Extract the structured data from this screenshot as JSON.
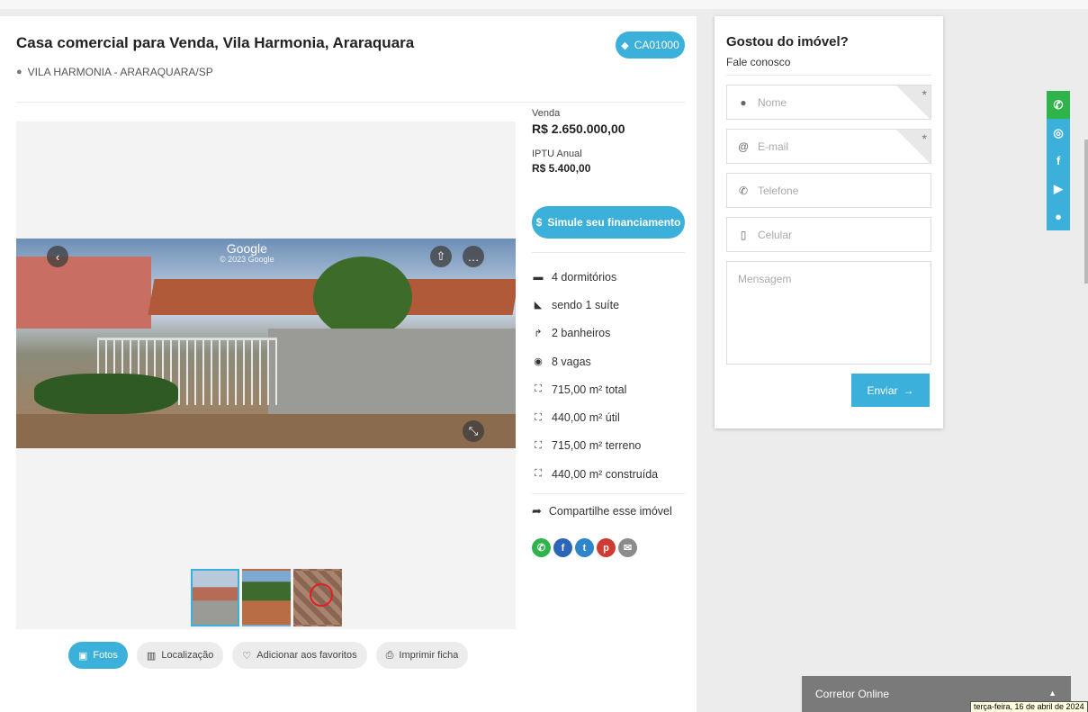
{
  "property": {
    "title": "Casa comercial para Venda, Vila Harmonia, Araraquara",
    "location": "VILA HARMONIA - ARARAQUARA/SP",
    "code": "CA01000"
  },
  "photo": {
    "google_label": "Google",
    "google_copy": "© 2023 Google"
  },
  "pricing": {
    "sale_label": "Venda",
    "sale_price": "R$ 2.650.000,00",
    "iptu_label": "IPTU Anual",
    "iptu_value": "R$ 5.400,00",
    "simulate_label": "Simule seu financiamento"
  },
  "features": [
    {
      "icon": "bed-icon",
      "glyph": "▬",
      "text": "4 dormitórios"
    },
    {
      "icon": "bathtub-icon",
      "glyph": "◣",
      "text": "sendo 1 suíte"
    },
    {
      "icon": "shower-icon",
      "glyph": "↱",
      "text": "2 banheiros"
    },
    {
      "icon": "car-icon",
      "glyph": "◉",
      "text": "8 vagas"
    },
    {
      "icon": "expand-icon",
      "glyph": "⛶",
      "text": "715,00 m² total"
    },
    {
      "icon": "expand-icon",
      "glyph": "⛶",
      "text": "440,00 m² útil"
    },
    {
      "icon": "expand-icon",
      "glyph": "⛶",
      "text": "715,00 m² terreno"
    },
    {
      "icon": "expand-icon",
      "glyph": "⛶",
      "text": "440,00 m² construída"
    }
  ],
  "share": {
    "label": "Compartilhe esse imóvel",
    "icons": [
      {
        "name": "whatsapp-share-icon",
        "glyph": "✆",
        "color": "#2fb44b"
      },
      {
        "name": "facebook-share-icon",
        "glyph": "f",
        "color": "#2c66b8"
      },
      {
        "name": "twitter-share-icon",
        "glyph": "t",
        "color": "#2c86c9"
      },
      {
        "name": "pinterest-share-icon",
        "glyph": "p",
        "color": "#cf3b32"
      },
      {
        "name": "email-share-icon",
        "glyph": "✉",
        "color": "#8b8b8b"
      }
    ]
  },
  "actions": {
    "photos": "Fotos",
    "location": "Localização",
    "favorites": "Adicionar aos favoritos",
    "print": "Imprimir ficha"
  },
  "contact_form": {
    "title": "Gostou do imóvel?",
    "subtitle": "Fale conosco",
    "name_placeholder": "Nome",
    "email_placeholder": "E-mail",
    "phone_placeholder": "Telefone",
    "mobile_placeholder": "Celular",
    "message_placeholder": "Mensagem",
    "required_mark": "*",
    "send_label": "Enviar"
  },
  "social_bar": [
    {
      "name": "whatsapp-icon",
      "glyph": "✆",
      "color": "#2fb44b"
    },
    {
      "name": "instagram-icon",
      "glyph": "◎",
      "color": "#3ab0da"
    },
    {
      "name": "facebook-icon",
      "glyph": "f",
      "color": "#3ab0da"
    },
    {
      "name": "youtube-icon",
      "glyph": "▶",
      "color": "#3ab0da"
    },
    {
      "name": "chat-icon",
      "glyph": "●",
      "color": "#3ab0da"
    }
  ],
  "corretor": {
    "label": "Corretor Online"
  },
  "tooltip": {
    "text": "terça-feira, 16 de abril de 2024"
  },
  "colors": {
    "accent": "#3ab0da"
  }
}
